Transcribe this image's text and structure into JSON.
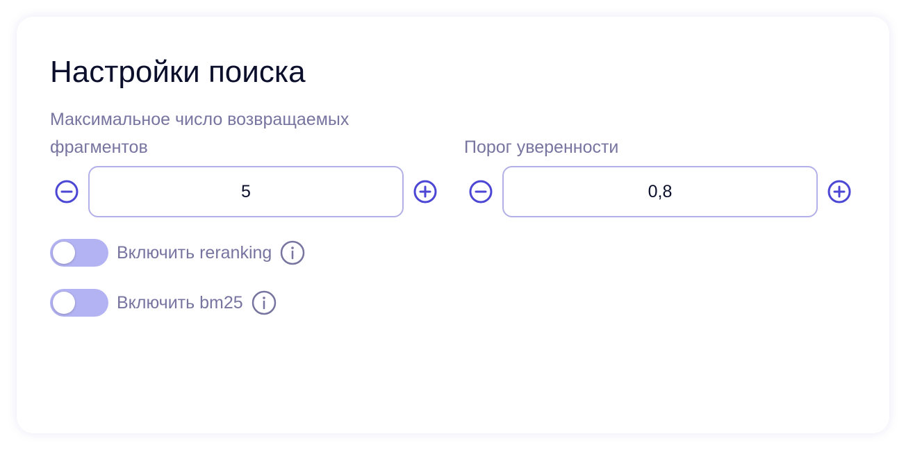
{
  "panel": {
    "title": "Настройки поиска"
  },
  "max_fragments": {
    "label": "Максимальное число возвращаемых фрагментов",
    "value": "5"
  },
  "confidence_threshold": {
    "label": "Порог уверенности",
    "value": "0,8"
  },
  "toggles": [
    {
      "label": "Включить reranking",
      "enabled": false,
      "icon": "info-icon"
    },
    {
      "label": "Включить bm25",
      "enabled": false,
      "icon": "info-icon"
    }
  ],
  "colors": {
    "accent": "#4b46d4",
    "title_text": "#0b0f2c",
    "muted_text": "#7774a0",
    "input_border": "#b3b0e8",
    "switch_track_off": "#b3b2f2"
  }
}
